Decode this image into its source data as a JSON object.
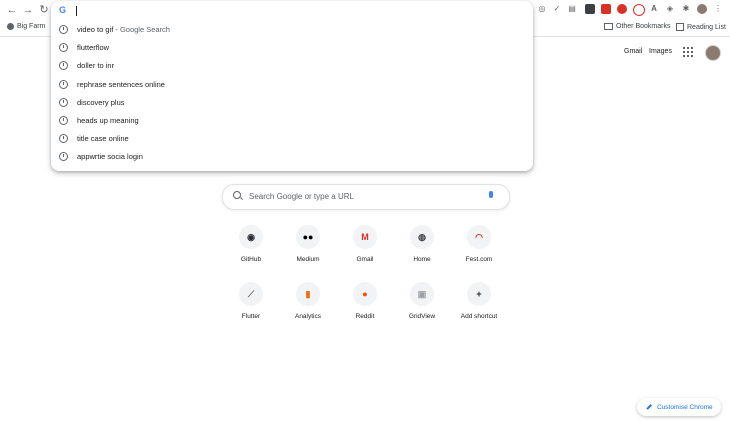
{
  "omnibox": {
    "input_value": "",
    "suggestions": [
      {
        "text": "video to gif",
        "suffix": " - Google Search"
      },
      {
        "text": "flutterflow",
        "suffix": ""
      },
      {
        "text": "doller to inr",
        "suffix": ""
      },
      {
        "text": "rephrase sentences online",
        "suffix": ""
      },
      {
        "text": "discovery plus",
        "suffix": ""
      },
      {
        "text": "heads up meaning",
        "suffix": ""
      },
      {
        "text": "title case online",
        "suffix": ""
      },
      {
        "text": "appwrtie socia login",
        "suffix": ""
      }
    ]
  },
  "bookmarks": {
    "left_item": "Big Farm",
    "other": "Other Bookmarks",
    "reading_list": "Reading List"
  },
  "header": {
    "gmail": "Gmail",
    "images": "Images"
  },
  "search": {
    "placeholder": "Search Google or type a URL"
  },
  "shortcuts": [
    {
      "label": "GitHub",
      "icon": "github-icon",
      "glyph": "◉",
      "color": "#24292e"
    },
    {
      "label": "Medium",
      "icon": "medium-icon",
      "glyph": "●●",
      "color": "#000000"
    },
    {
      "label": "Gmail",
      "icon": "gmail-icon",
      "glyph": "M",
      "color": "#d93025"
    },
    {
      "label": "Home",
      "icon": "globe-icon",
      "glyph": "◍",
      "color": "#3c4043"
    },
    {
      "label": "Fest.com",
      "icon": "gauge-icon",
      "glyph": "◠",
      "color": "#d93025"
    },
    {
      "label": "Flutter",
      "icon": "flutter-icon",
      "glyph": "⟋",
      "color": "#5f6368"
    },
    {
      "label": "Analytics",
      "icon": "analytics-icon",
      "glyph": "▮",
      "color": "#e8710a"
    },
    {
      "label": "Reddit",
      "icon": "reddit-icon",
      "glyph": "●",
      "color": "#ff4500"
    },
    {
      "label": "GridView",
      "icon": "gridview-icon",
      "glyph": "▣",
      "color": "#9aa0a6"
    },
    {
      "label": "Add shortcut",
      "icon": "plus-icon",
      "glyph": "+",
      "color": "#202124"
    }
  ],
  "customise": {
    "label": "Customise Chrome"
  }
}
